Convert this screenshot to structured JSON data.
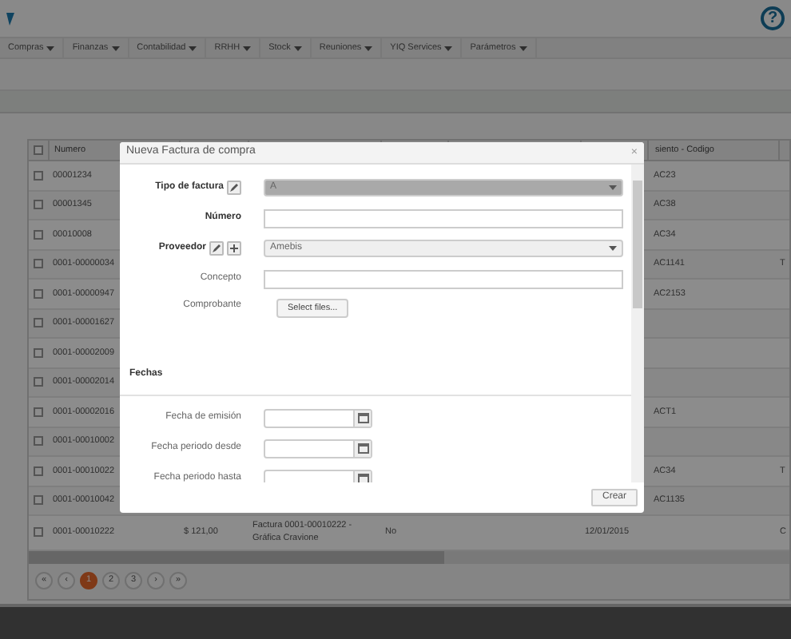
{
  "header": {
    "help_symbol": "?"
  },
  "menu": [
    {
      "label": "Compras"
    },
    {
      "label": "Finanzas"
    },
    {
      "label": "Contabilidad"
    },
    {
      "label": "RRHH"
    },
    {
      "label": "Stock"
    },
    {
      "label": "Reuniones"
    },
    {
      "label": "YIQ Services"
    },
    {
      "label": "Parámetros"
    }
  ],
  "table": {
    "all_checked": false,
    "columns": [
      {
        "label": "Numero"
      },
      {
        "label": "siento - Codigo"
      }
    ],
    "rows": [
      {
        "checked": false,
        "numero": "00001234",
        "codigo": "AC23"
      },
      {
        "checked": false,
        "numero": "00001345",
        "codigo": "AC38"
      },
      {
        "checked": false,
        "numero": "00010008",
        "codigo": "AC34"
      },
      {
        "checked": false,
        "numero": "0001-00000034",
        "codigo": "AC1141",
        "column_9": "T"
      },
      {
        "checked": false,
        "numero": "0001-00000947",
        "codigo": "AC2153"
      },
      {
        "checked": false,
        "numero": "0001-00001627"
      },
      {
        "checked": false,
        "numero": "0001-00002009"
      },
      {
        "checked": false,
        "numero": "0001-00002014"
      },
      {
        "checked": false,
        "numero": "0001-00002016",
        "codigo": "ACT1"
      },
      {
        "checked": false,
        "numero": "0001-00010002"
      },
      {
        "checked": false,
        "numero": "0001-00010022",
        "codigo": "AC34",
        "column_9": "T"
      },
      {
        "checked": false,
        "numero": "0001-00010042",
        "codigo": "AC1135"
      },
      {
        "checked": false,
        "numero": "0001-00010222",
        "importe": "$ 121,00",
        "descripcion": "Factura 0001-00010222 - Gráfica Cravione",
        "column_5": "No",
        "fecha": "12/01/2015",
        "column_9": "C"
      }
    ]
  },
  "pager": [
    {
      "label": "«",
      "selected": false
    },
    {
      "label": "‹",
      "selected": false
    },
    {
      "label": "1",
      "selected": true
    },
    {
      "label": "2",
      "selected": false
    },
    {
      "label": "3",
      "selected": false
    },
    {
      "label": "›",
      "selected": false
    },
    {
      "label": "»",
      "selected": false
    }
  ],
  "dialog": {
    "title": "Nueva Factura de compra",
    "close": "×",
    "fields": [
      {
        "kind": "select",
        "label": "Tipo de factura",
        "bold": true,
        "edit_button": true,
        "value": "A",
        "disabled": true
      },
      {
        "kind": "input",
        "label": "Número",
        "bold": true
      },
      {
        "kind": "select",
        "label": "Proveedor",
        "bold": true,
        "edit_button": true,
        "add_button": true,
        "value": "Amebis",
        "disabled": false
      },
      {
        "kind": "input",
        "label": "Concepto",
        "bold": false
      },
      {
        "kind": "file",
        "label": "Comprobante",
        "bold": false,
        "button": "Select files..."
      },
      {
        "kind": "section",
        "label": "Fechas"
      },
      {
        "kind": "date",
        "label": "Fecha de emisión"
      },
      {
        "kind": "date",
        "label": "Fecha periodo desde"
      },
      {
        "kind": "date",
        "label": "Fecha periodo hasta"
      }
    ],
    "submit": "Crear"
  }
}
